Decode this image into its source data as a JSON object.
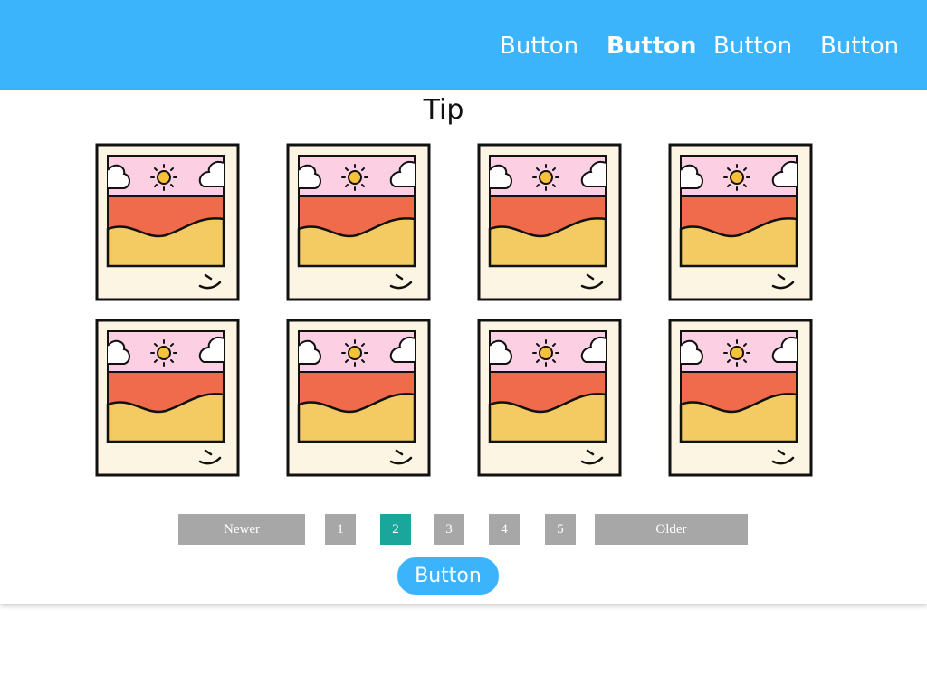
{
  "header": {
    "nav": [
      {
        "label": "Button",
        "active": false
      },
      {
        "label": "Button",
        "active": true
      },
      {
        "label": "Button",
        "active": false
      },
      {
        "label": "Button",
        "active": false
      }
    ]
  },
  "main": {
    "title": "Tip",
    "gallery": {
      "item_icon": "polaroid-landscape-icon",
      "rows": 2,
      "columns": 4,
      "items": [
        {
          "icon": "polaroid-landscape-icon"
        },
        {
          "icon": "polaroid-landscape-icon"
        },
        {
          "icon": "polaroid-landscape-icon"
        },
        {
          "icon": "polaroid-landscape-icon"
        },
        {
          "icon": "polaroid-landscape-icon"
        },
        {
          "icon": "polaroid-landscape-icon"
        },
        {
          "icon": "polaroid-landscape-icon"
        },
        {
          "icon": "polaroid-landscape-icon"
        }
      ]
    },
    "pagination": {
      "newer_label": "Newer",
      "older_label": "Older",
      "pages": [
        "1",
        "2",
        "3",
        "4",
        "5"
      ],
      "current_page": "2"
    },
    "cta_label": "Button"
  },
  "colors": {
    "header_bg": "#3bb4fb",
    "pager_bg": "#a7a7a7",
    "pager_active": "#1aa69a",
    "cta_bg": "#3bb4fb",
    "photo_sky": "#fcd0e2",
    "photo_sun": "#f7c23a",
    "photo_sea": "#ef6b4b",
    "photo_sand": "#f3cb62",
    "photo_frame": "#fdf5e4"
  }
}
